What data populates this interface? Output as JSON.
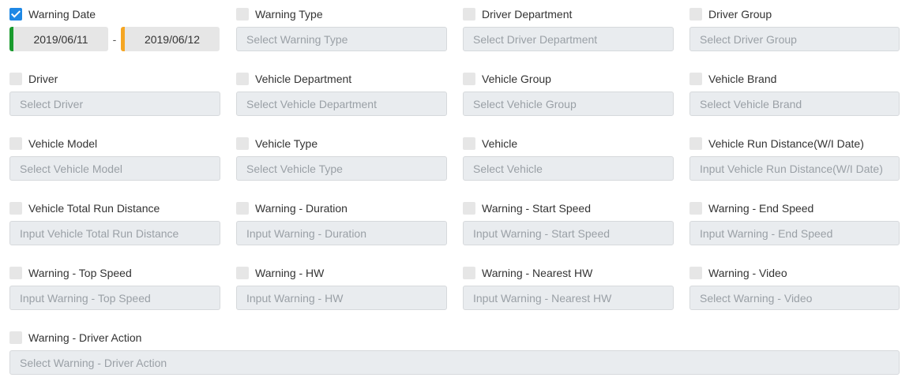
{
  "warning_date": {
    "label": "Warning Date",
    "checked": true,
    "start": "2019/06/11",
    "separator": "-",
    "end": "2019/06/12",
    "start_color": "#1a9b2e",
    "end_color": "#f5a623"
  },
  "fields": [
    {
      "id": "warning-type",
      "label": "Warning Type",
      "placeholder": "Select Warning Type"
    },
    {
      "id": "driver-department",
      "label": "Driver Department",
      "placeholder": "Select Driver Department"
    },
    {
      "id": "driver-group",
      "label": "Driver Group",
      "placeholder": "Select Driver Group"
    },
    {
      "id": "driver",
      "label": "Driver",
      "placeholder": "Select Driver"
    },
    {
      "id": "vehicle-department",
      "label": "Vehicle Department",
      "placeholder": "Select Vehicle Department"
    },
    {
      "id": "vehicle-group",
      "label": "Vehicle Group",
      "placeholder": "Select Vehicle Group"
    },
    {
      "id": "vehicle-brand",
      "label": "Vehicle Brand",
      "placeholder": "Select Vehicle Brand"
    },
    {
      "id": "vehicle-model",
      "label": "Vehicle Model",
      "placeholder": "Select Vehicle Model"
    },
    {
      "id": "vehicle-type",
      "label": "Vehicle Type",
      "placeholder": "Select Vehicle Type"
    },
    {
      "id": "vehicle",
      "label": "Vehicle",
      "placeholder": "Select Vehicle"
    },
    {
      "id": "vehicle-run-distance",
      "label": "Vehicle Run Distance(W/I Date)",
      "placeholder": "Input Vehicle Run Distance(W/I Date)"
    },
    {
      "id": "vehicle-total-run-distance",
      "label": "Vehicle Total Run Distance",
      "placeholder": "Input Vehicle Total Run Distance"
    },
    {
      "id": "warning-duration",
      "label": "Warning - Duration",
      "placeholder": "Input Warning - Duration"
    },
    {
      "id": "warning-start-speed",
      "label": "Warning - Start Speed",
      "placeholder": "Input Warning - Start Speed"
    },
    {
      "id": "warning-end-speed",
      "label": "Warning - End Speed",
      "placeholder": "Input Warning - End Speed"
    },
    {
      "id": "warning-top-speed",
      "label": "Warning - Top Speed",
      "placeholder": "Input Warning - Top Speed"
    },
    {
      "id": "warning-hw",
      "label": "Warning - HW",
      "placeholder": "Input Warning - HW"
    },
    {
      "id": "warning-nearest-hw",
      "label": "Warning - Nearest HW",
      "placeholder": "Input Warning - Nearest HW"
    },
    {
      "id": "warning-video",
      "label": "Warning - Video",
      "placeholder": "Select Warning - Video"
    },
    {
      "id": "warning-driver-action",
      "label": "Warning - Driver Action",
      "placeholder": "Select Warning - Driver Action",
      "full": true
    }
  ]
}
